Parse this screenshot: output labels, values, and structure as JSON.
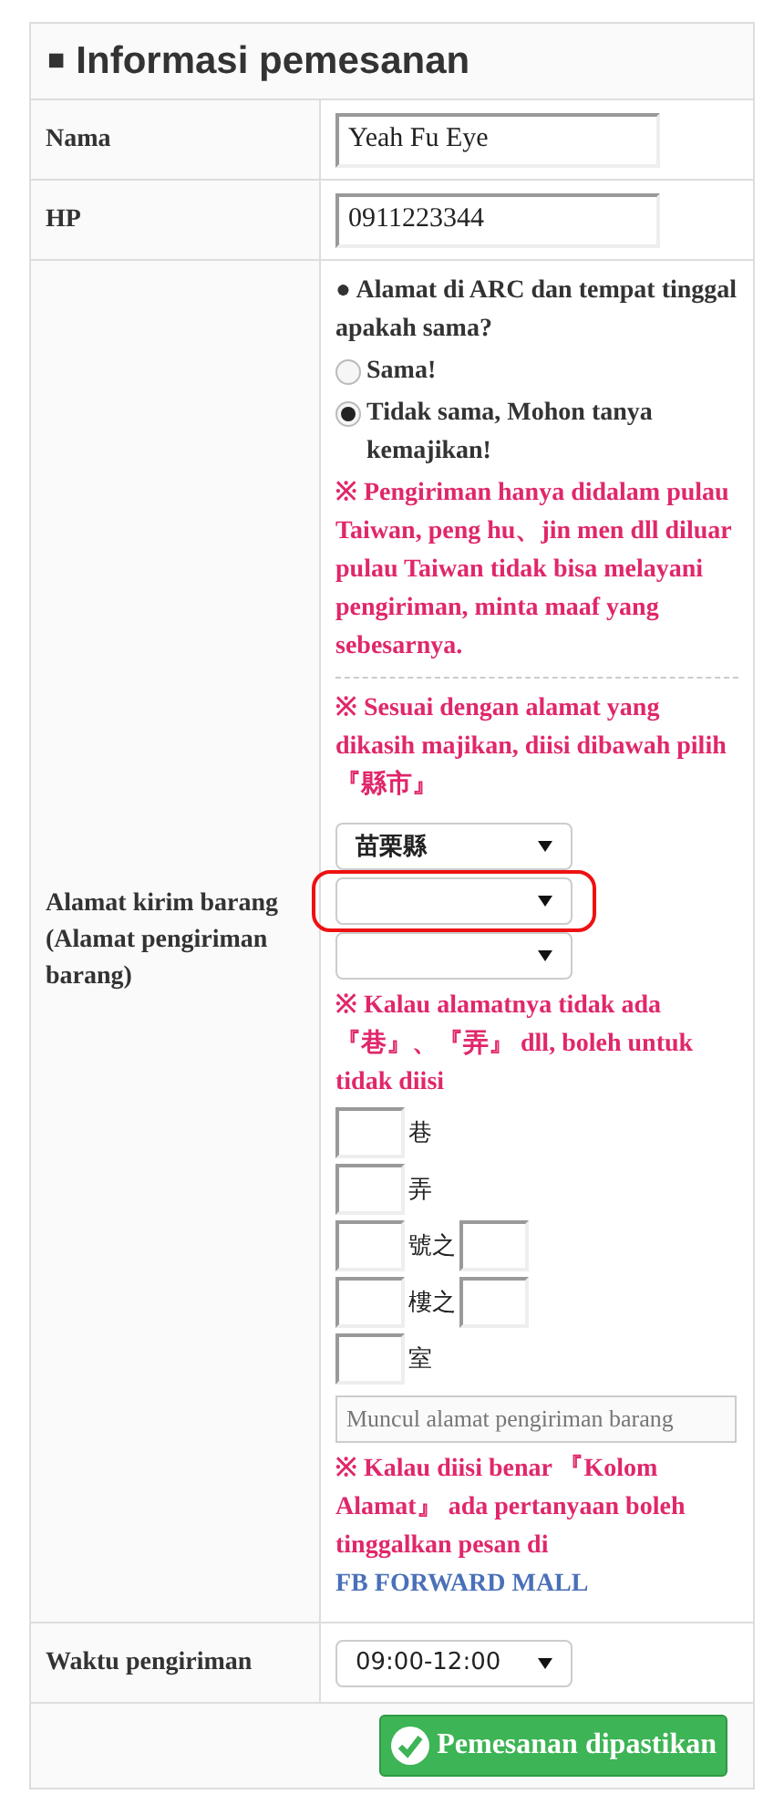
{
  "header": {
    "marker": "■",
    "title": "Informasi pemesanan"
  },
  "rows": [
    {
      "label": "Nama",
      "value": "Yeah Fu Eye"
    },
    {
      "label": "HP",
      "value": "0911223344"
    }
  ],
  "address": {
    "label": "Alamat kirim barang (Alamat pengiriman barang)",
    "question": {
      "bullet": "●",
      "text": "Alamat di ARC dan tempat tinggal apakah sama?"
    },
    "options": [
      {
        "label": "Sama!",
        "selected": false
      },
      {
        "label": "Tidak sama, Mohon tanya kemajikan!",
        "selected": true
      }
    ],
    "note_1": "※ Pengiriman hanya didalam pulau Taiwan, peng hu、jin men dll diluar pulau Taiwan tidak bisa melayani pengiriman, minta maaf yang sebesarnya.",
    "note_2": "※ Sesuai dengan alamat yang dikasih majikan, diisi dibawah pilih『縣市』",
    "selects": [
      {
        "value": "苗栗縣",
        "highlighted": false
      },
      {
        "highlighted": true
      },
      {
        "highlighted": false
      }
    ],
    "note_3": "※ Kalau alamatnya tidak ada『巷』、『弄』 dll, boleh untuk tidak diisi",
    "unit_fields": [
      {
        "kind": "single",
        "unit": "巷"
      },
      {
        "kind": "single",
        "unit": "弄"
      },
      {
        "kind": "pair",
        "unit": "號之"
      },
      {
        "kind": "pair",
        "unit": "樓之"
      },
      {
        "kind": "single",
        "unit": "室"
      }
    ],
    "preview": {
      "placeholder": "Muncul alamat pengiriman barang"
    },
    "note_4": "※ Kalau diisi benar 『Kolom Alamat』 ada pertanyaan boleh tinggalkan pesan di",
    "note_4_link": "FB FORWARD MALL"
  },
  "delivery": {
    "label": "Waktu pengiriman",
    "value": "09:00-12:00"
  },
  "submit": {
    "label": "Pemesanan dipastikan"
  }
}
